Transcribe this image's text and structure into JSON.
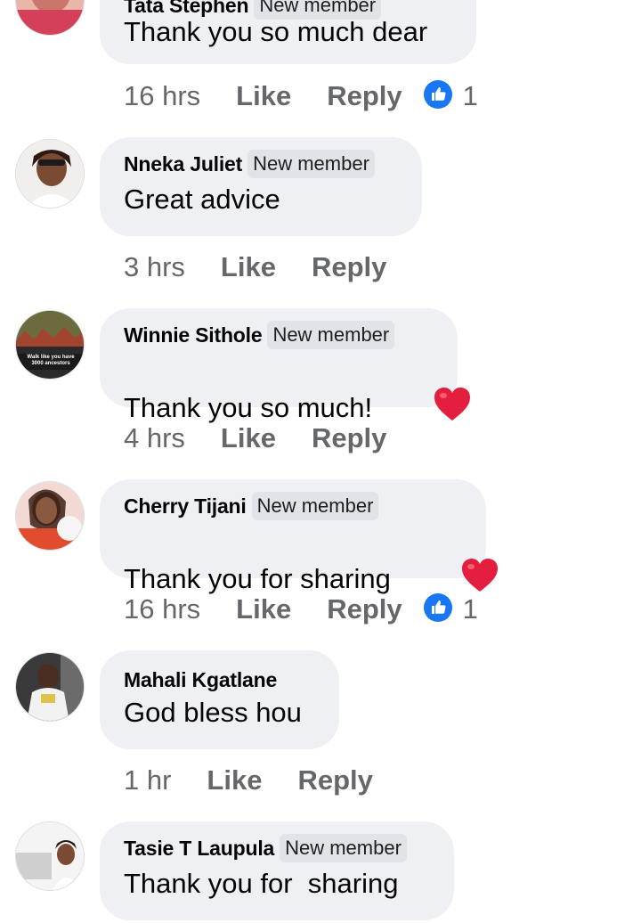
{
  "comments": [
    {
      "name": "Tata Stephen",
      "badge": "New member",
      "text": "Thank you so much dear",
      "time": "16 hrs",
      "like": "Like",
      "reply": "Reply",
      "reaction_count": "1"
    },
    {
      "name": "Nneka Juliet",
      "badge": "New member",
      "text": "Great advice",
      "time": "3 hrs",
      "like": "Like",
      "reply": "Reply"
    },
    {
      "name": "Winnie Sithole",
      "badge": "New member",
      "text": "Thank you so much!",
      "time": "4 hrs",
      "like": "Like",
      "reply": "Reply",
      "avatar_caption": "Walk like you have 3000 ancestors"
    },
    {
      "name": "Cherry Tijani",
      "badge": "New member",
      "text": "Thank you for sharing ",
      "time": "16 hrs",
      "like": "Like",
      "reply": "Reply",
      "reaction_count": "1"
    },
    {
      "name": "Mahali Kgatlane",
      "text": "God bless hou",
      "time": "1 hr",
      "like": "Like",
      "reply": "Reply"
    },
    {
      "name": "Tasie T Laupula",
      "badge": "New member",
      "text": "Thank you for  sharing"
    }
  ],
  "icons": {
    "like_reaction": "thumbs-up-icon",
    "heart": "red-heart-icon"
  },
  "colors": {
    "bubble": "#eff0f3",
    "meta_text": "#65676b",
    "like_blue": "#1877f2",
    "heart_red": "#e41e3f"
  }
}
